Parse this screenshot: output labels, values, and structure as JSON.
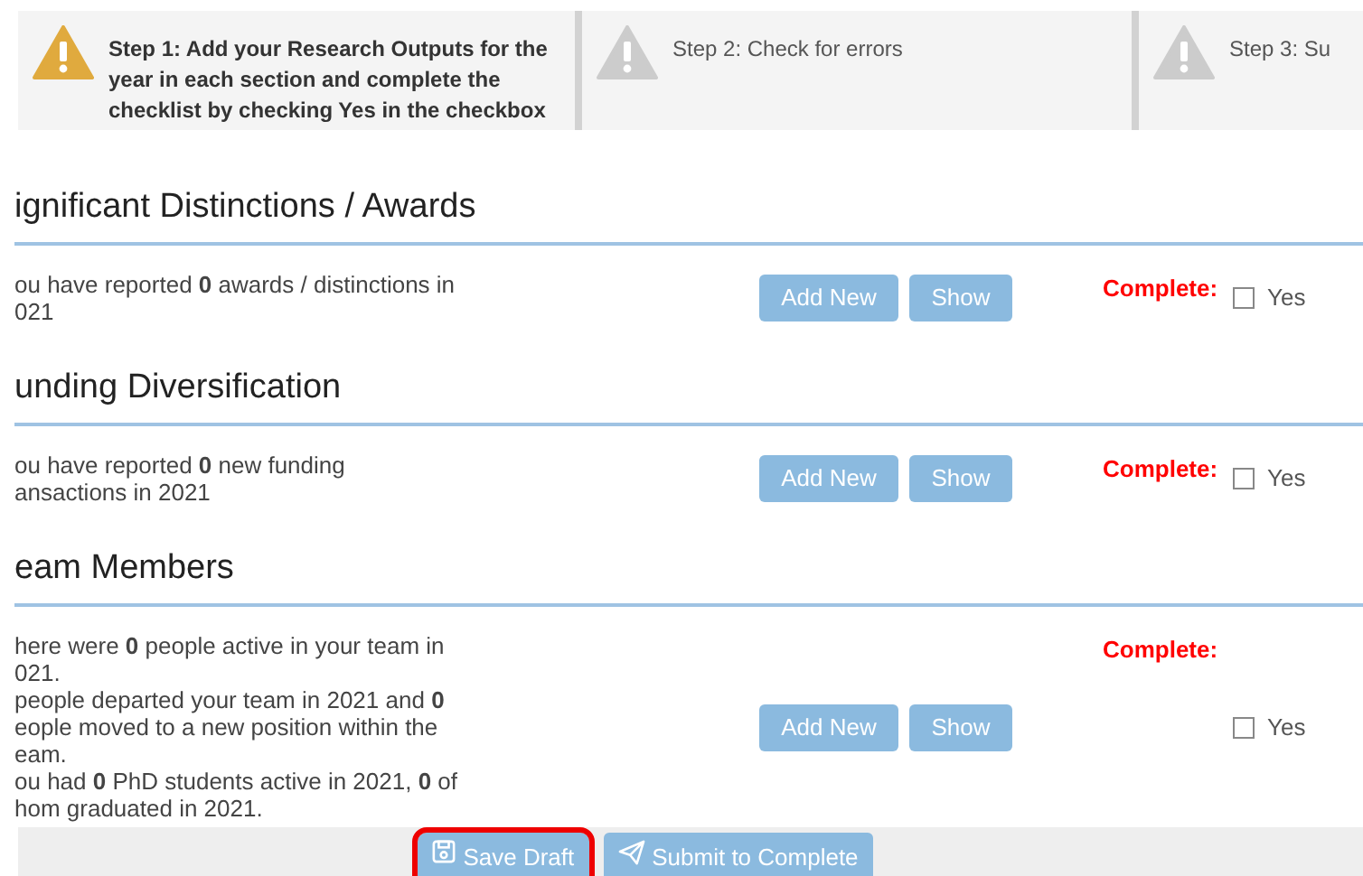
{
  "steps": [
    {
      "text": "Step 1: Add your Research Outputs for the year in each section and complete the checklist by checking Yes in the checkbox",
      "selected": true
    },
    {
      "text": "Step 2: Check for errors",
      "selected": false
    },
    {
      "text": "Step 3: Su",
      "selected": false
    }
  ],
  "sections": [
    {
      "title": "ignificant Distinctions / Awards",
      "lines": [
        "ou have reported **0** awards / distinctions in",
        "021"
      ],
      "buttons": [
        "Add New",
        "Show"
      ],
      "complete_label": "Complete:",
      "checkbox": {
        "label": "Yes",
        "checked": false
      }
    },
    {
      "title": "unding Diversification",
      "lines": [
        "ou have reported **0** new funding",
        "ansactions in 2021"
      ],
      "buttons": [
        "Add New",
        "Show"
      ],
      "complete_label": "Complete:",
      "checkbox": {
        "label": "Yes",
        "checked": false
      }
    },
    {
      "title": "eam Members",
      "lines": [
        "here were **0** people active in your team in",
        "021.",
        "people departed your team in 2021 and **0**",
        "eople moved to a new position within the",
        "eam.",
        "ou had **0** PhD students active in 2021, **0** of",
        "hom graduated in 2021."
      ],
      "buttons": [
        "Add New",
        "Show"
      ],
      "complete_label": "Complete:",
      "checkbox": {
        "label": "Yes",
        "checked": false
      }
    }
  ],
  "footer": [
    {
      "label": "Save Draft",
      "kind": "save",
      "highlighted": true
    },
    {
      "label": "Submit to Complete",
      "kind": "submit",
      "highlighted": false
    }
  ]
}
